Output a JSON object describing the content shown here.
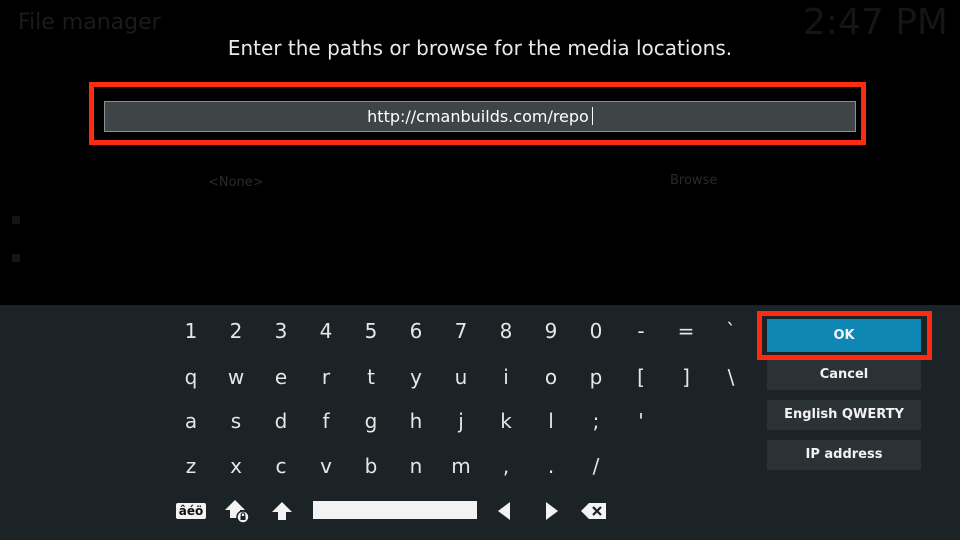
{
  "background": {
    "title": "File manager",
    "clock": "2:47 PM",
    "source_value": "<None>",
    "browse_label": "Browse"
  },
  "dialog": {
    "heading": "Enter the paths or browse for the media locations.",
    "path_value": "http://cmanbuilds.com/repo"
  },
  "keyboard": {
    "row1": [
      "1",
      "2",
      "3",
      "4",
      "5",
      "6",
      "7",
      "8",
      "9",
      "0",
      "-",
      "=",
      "`"
    ],
    "row2": [
      "q",
      "w",
      "e",
      "r",
      "t",
      "y",
      "u",
      "i",
      "o",
      "p",
      "[",
      "]",
      "\\"
    ],
    "row3": [
      "a",
      "s",
      "d",
      "f",
      "g",
      "h",
      "j",
      "k",
      "l",
      ";",
      "'"
    ],
    "row4": [
      "z",
      "x",
      "c",
      "v",
      "b",
      "n",
      "m",
      ",",
      ".",
      "/"
    ],
    "symbols_label": "âéö"
  },
  "buttons": {
    "ok": "OK",
    "cancel": "Cancel",
    "layout": "English QWERTY",
    "ip": "IP address"
  },
  "colors": {
    "highlight": "#ff2a12",
    "ok_accent": "#0f87b4",
    "panel": "#1c2327"
  }
}
